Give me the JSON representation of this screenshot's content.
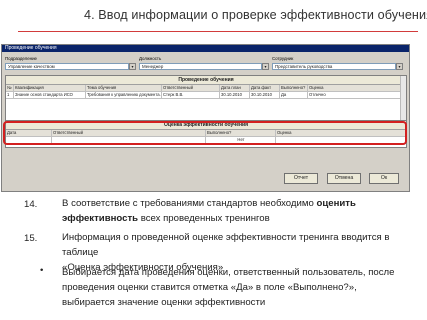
{
  "slide": {
    "title": "4. Ввод информации о проверке эффективности обучения"
  },
  "window": {
    "title": "Проведение обучения",
    "fields": {
      "dept_label": "Подразделение",
      "dept_value": "Управление качеством",
      "position_label": "Должность",
      "position_value": "Менеджер",
      "employee_label": "Сотрудник",
      "employee_value": "Представитель руководства"
    },
    "training": {
      "header": "Проведение обучения",
      "columns": [
        "№",
        "Квалификация",
        "Тема обучения",
        "Ответственный",
        "Дата план",
        "Дата факт",
        "Выполнено?",
        "Оценка"
      ],
      "rows": [
        [
          "1",
          "Знание основ стандарта ИСО",
          "Требования к управлению документа...",
          "Стерк В.В.",
          "30.10.2010",
          "30.10.2010",
          "Да",
          "Отлично"
        ]
      ]
    },
    "evaluation": {
      "header": "Оценка эффективности обучения",
      "columns": [
        "Дата",
        "Ответственный",
        "Выполнено?",
        "Оценка"
      ],
      "rows": [
        [
          "",
          "",
          "Нет",
          ""
        ]
      ]
    },
    "buttons": {
      "report": "Отчет",
      "cancel": "Отмена",
      "ok": "Ок"
    }
  },
  "items": [
    {
      "num": "14.",
      "pre": "В соответствие с требованиями стандартов необходимо ",
      "bold1": "оценить",
      "bold2": "эффективность",
      "post": " всех проведенных тренингов"
    },
    {
      "num": "15.",
      "line1": "Информация о проведенной оценке эффективности тренинга вводится в таблице",
      "line2": "«Оценка эффективности обучения»"
    }
  ],
  "bullet": {
    "symbol": "•",
    "line1": "Выбирается дата проведения оценки, ответственный пользователь, после",
    "line2": "проведения оценки ставится отметка «Да» в поле «Выполнено?»,",
    "line3": "выбирается значение оценки эффективности"
  },
  "colors": {
    "accent_line": "#d23b3b",
    "highlight_box": "#d32020",
    "titlebar": "#0a246a"
  }
}
